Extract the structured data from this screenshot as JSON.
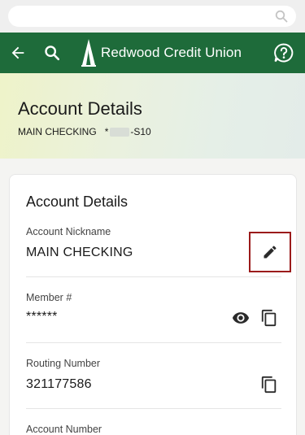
{
  "header": {
    "brand_name": "Redwood Credit Union",
    "icons": [
      "back-arrow-icon",
      "search-icon",
      "redwood-logo-icon",
      "help-chat-icon"
    ]
  },
  "hero": {
    "title": "Account Details",
    "account_name": "MAIN CHECKING",
    "account_prefix": "*",
    "account_suffix": "-S10"
  },
  "card": {
    "title": "Account Details",
    "fields": [
      {
        "label": "Account Nickname",
        "value": "MAIN CHECKING"
      },
      {
        "label": "Member #",
        "value": "******"
      },
      {
        "label": "Routing Number",
        "value": "321177586"
      },
      {
        "label": "Account Number",
        "value": ""
      }
    ]
  },
  "colors": {
    "header_green": "#1e6b3a",
    "highlight_border": "#9b1b1b"
  }
}
